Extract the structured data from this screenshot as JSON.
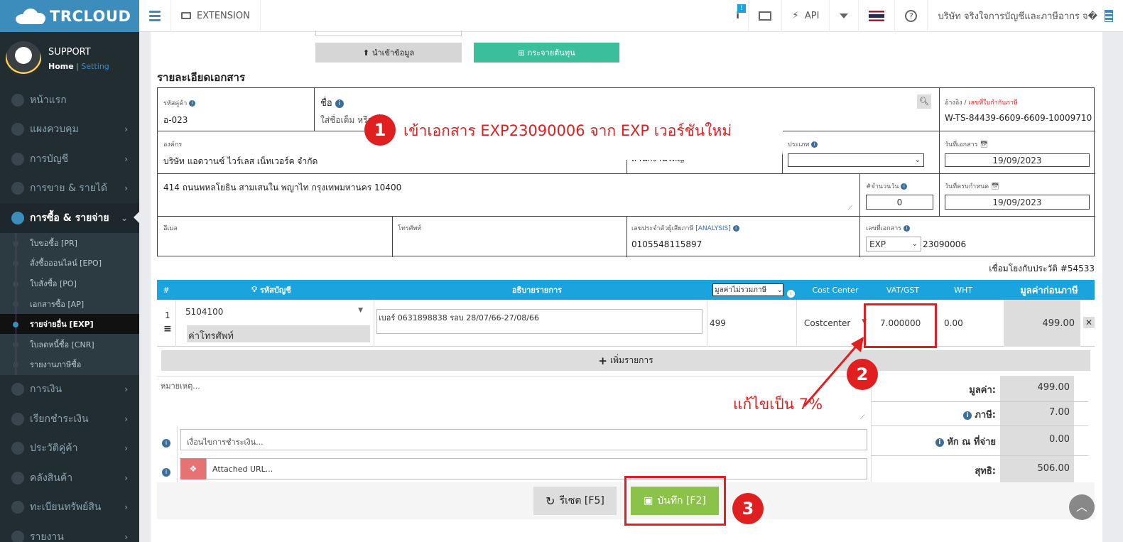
{
  "brand": {
    "name": "TRCLOUD"
  },
  "user": {
    "name": "SUPPORT",
    "home": "Home",
    "sep": "|",
    "setting": "Setting"
  },
  "topbar": {
    "extension": "EXTENSION",
    "notif_count": "!",
    "api": "API",
    "company": "บริษัท จริงใจการบัญชีและภาษีอากร จ�"
  },
  "menu": [
    {
      "label": "หน้าแรก",
      "icon": "dashboard-icon"
    },
    {
      "label": "แผงควบคุม",
      "icon": "monitor-icon"
    },
    {
      "label": "การบัญชี",
      "icon": "book-icon"
    },
    {
      "label": "การขาย & รายได้",
      "icon": "dollar-icon"
    },
    {
      "label": "การซื้อ & รายจ่าย",
      "icon": "cart-icon"
    }
  ],
  "submenu": [
    "ใบขอซื้อ [PR]",
    "สั่งซื้อออนไลน์ [EPO]",
    "ใบสั่งซื้อ [PO]",
    "เอกสารซื้อ [AP]",
    "รายจ่ายอื่น [EXP]",
    "ใบลดหนี้ซื้อ [CNR]",
    "รายงานภาษีซื้อ"
  ],
  "menu2": [
    {
      "label": "การเงิน",
      "icon": "calendar-icon"
    },
    {
      "label": "เรียกชำระเงิน",
      "icon": "card-icon"
    },
    {
      "label": "ประวัติคู่ค้า",
      "icon": "contact-icon"
    },
    {
      "label": "คลังสินค้า",
      "icon": "cubes-icon"
    },
    {
      "label": "ทะเบียนทรัพย์สิน",
      "icon": "diamond-icon"
    },
    {
      "label": "รายงาน",
      "icon": "report-icon"
    }
  ],
  "actions": {
    "import": "นำเข้าข้อมูล",
    "distribute": "กระจายต้นทุน"
  },
  "section_title": "รายละเอียดเอกสาร",
  "doc": {
    "customer_code_label": "รหัสคู่ค้า",
    "customer_code": "อ-023",
    "name_label": "ชื่อ",
    "name_placeholder": "ใส่ชื่อเต็ม หรือ ชื่อย่อ",
    "ref_label": "อ้างอิง",
    "ref_sep": "/",
    "taxinv_label": "เลขที่ใบกำกับภาษี",
    "ref_value": "W-TS-84439-6609-6609-10009710",
    "org_label": "องค์กร",
    "org_value": "บริษัท แอดวานซ์ ไวร์เลส เน็ทเวอร์ค จำกัด",
    "branch_value": "สำนักงานใหญ่",
    "type_label": "ประเภท",
    "docdate_label": "วันที่เอกสาร",
    "docdate": "19/09/2023",
    "address": "414  ถนนพหลโยธิน สามเสนใน พญาไท กรุงเทพมหานคร 10400",
    "days_label": "#จำนวนวัน",
    "days": "0",
    "duedate_label": "วันที่ครบกำหนด",
    "duedate": "19/09/2023",
    "email_label": "อีเมล",
    "phone_label": "โทรศัพท์",
    "taxid_label": "เลขประจำตัวผู้เสียภาษี",
    "analysis": "ANALYSIS",
    "taxid": "0105548115897",
    "docno_label": "เลขที่เอกสาร",
    "prefix": "EXP",
    "docno": "23090006",
    "link_text": "เชื่อมโยงกับประวัติ #54533"
  },
  "table": {
    "headers": {
      "no": "#",
      "account": "รหัสบัญชี",
      "desc": "อธิบายรายการ",
      "price_mode": "มูลค่าไม่รวมภาษี",
      "cost_center": "Cost Center",
      "vat": "VAT/GST",
      "wht": "WHT",
      "amount": "มูลค่าก่อนภาษี"
    },
    "rows": [
      {
        "no": "1",
        "account": "5104100",
        "account_name": "ค่าโทรศัพท์",
        "desc": "เบอร์ 0631898838 รอบ 28/07/66-27/08/66",
        "price": "499",
        "cost_center": "Costcenter",
        "vat": "7.000000",
        "wht": "0.00",
        "amount": "499.00"
      }
    ],
    "add_row": "เพิ่มรายการ"
  },
  "remark_placeholder": "หมายเหตุ...",
  "payment_placeholder": "เงื่อนไขการชำระเงิน...",
  "attached_placeholder": "Attached URL...",
  "totals": {
    "value_label": "มูลค่า:",
    "value": "499.00",
    "tax_label": "ภาษี:",
    "tax": "7.00",
    "wht_label": "หัก ณ ที่จ่าย",
    "wht": "0.00",
    "net_label": "สุทธิ:",
    "net": "506.00"
  },
  "buttons": {
    "reset": "รีเซต [F5]",
    "save": "บันทึก [F2]"
  },
  "callouts": {
    "step1_num": "1",
    "step1_text": "เข้าเอกสาร EXP23090006 จาก EXP เวอร์ชันใหม่",
    "step2_num": "2",
    "step2_text": "แก้ไขเป็น 7%",
    "step3_num": "3"
  },
  "colors": {
    "header_blue": "#1aa3dc",
    "teal": "#3bbf9a",
    "save_green": "#8bc34a",
    "annot_red": "#e02020",
    "sidebar": "#222d32",
    "brand_blue": "#3c8dbc"
  }
}
